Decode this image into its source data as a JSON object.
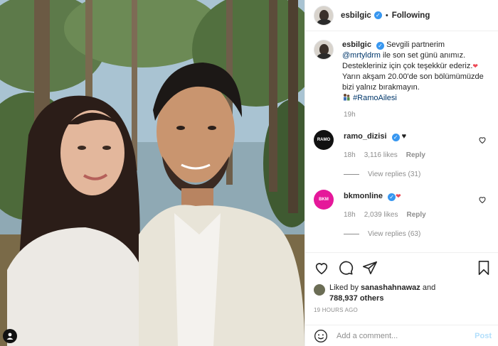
{
  "post": {
    "username": "esbilgic",
    "follow_status": "Following",
    "separator": "•"
  },
  "caption": {
    "username": "esbilgic",
    "line1": "Sevgili partnerim",
    "mention": "@mrtyldrm",
    "line2": " ile son set günü anımız.",
    "line3": "Destekleriniz için çok teşekkür ederiz.",
    "line4": "Yarın akşam 20.00'de son bölümümüzde bizi yalnız bırakmayın.",
    "hashtag": "#RamoAilesi",
    "time": "19h"
  },
  "comments": [
    {
      "username": "ramo_dizisi",
      "avatar_text": "RAMO",
      "avatar_color": "#111111",
      "time": "18h",
      "likes": "3,116 likes",
      "reply_label": "Reply",
      "view_replies": "View replies (31)"
    },
    {
      "username": "bkmonline",
      "avatar_text": "BKM",
      "avatar_color": "#e5189a",
      "time": "18h",
      "likes": "2,039 likes",
      "reply_label": "Reply",
      "view_replies": "View replies (63)"
    }
  ],
  "likes": {
    "prefix": "Liked by ",
    "by_user": "sanashahnawaz",
    "and": " and",
    "others": "788,937 others"
  },
  "posted_time": "19 HOURS AGO",
  "add_comment": {
    "placeholder": "Add a comment...",
    "post_label": "Post"
  },
  "icons": {
    "verified": "verified-badge-icon",
    "heart": "heart-icon",
    "comment": "comment-icon",
    "share": "share-icon",
    "save": "bookmark-icon",
    "emoji": "smile-icon",
    "user": "user-icon"
  },
  "colors": {
    "accent_blue": "#3897f0",
    "heart_red": "#ed4956",
    "link": "#00376b",
    "muted": "#8e8e8e"
  }
}
